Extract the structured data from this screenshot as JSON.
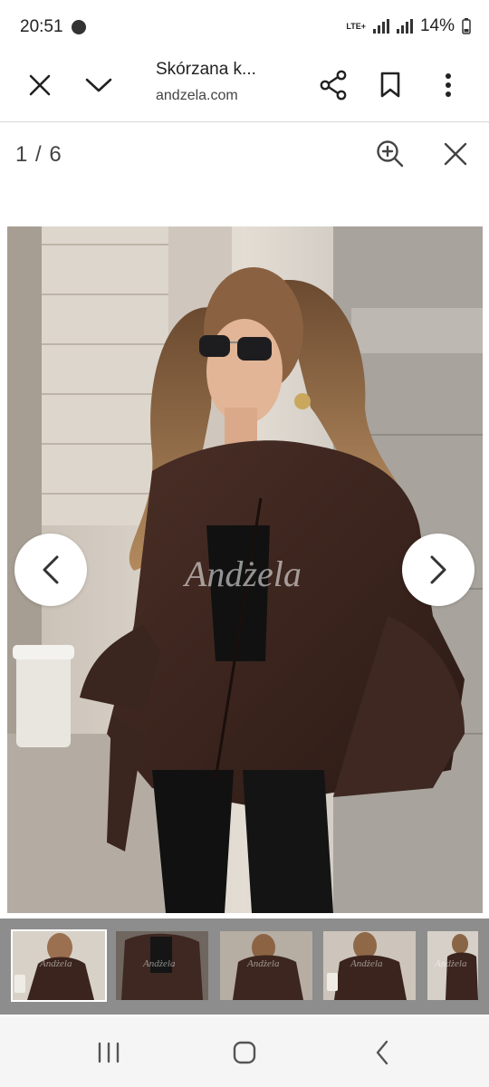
{
  "status": {
    "time": "20:51",
    "network": "LTE+",
    "battery": "14%"
  },
  "toolbar": {
    "title": "Skórzana k...",
    "url": "andzela.com"
  },
  "viewer": {
    "counter": "1 / 6",
    "watermark": "Andżela"
  },
  "icons": {
    "close": "close-icon",
    "chevron": "chevron-down-icon",
    "share": "share-icon",
    "bookmark": "bookmark-icon",
    "menu": "more-vert-icon",
    "zoom": "zoom-in-icon",
    "prev": "chevron-left-icon",
    "next": "chevron-right-icon"
  },
  "thumbnails": [
    {
      "watermark": "Andżela"
    },
    {
      "watermark": "Andżela"
    },
    {
      "watermark": "Andżela"
    },
    {
      "watermark": "Andżela"
    },
    {
      "watermark": "Andżela"
    }
  ]
}
